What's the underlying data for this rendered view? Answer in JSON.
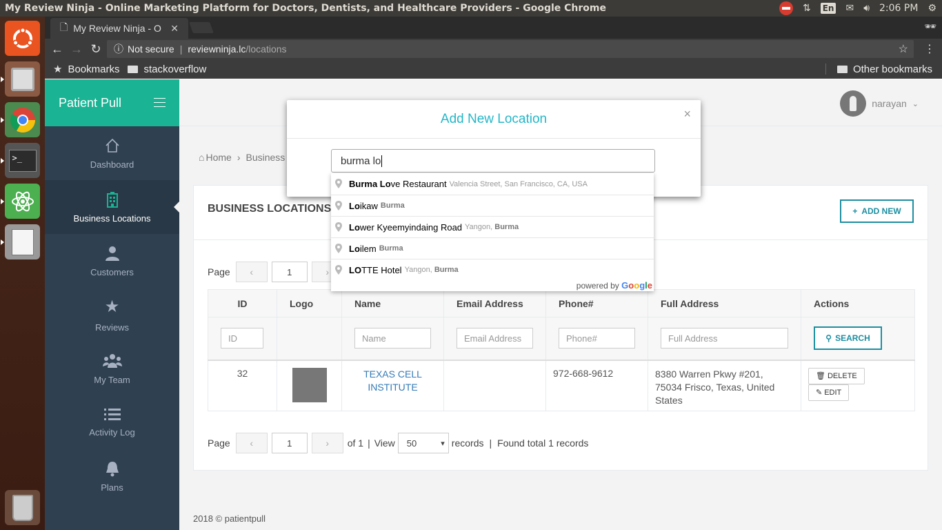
{
  "os": {
    "window_title": "My Review Ninja - Online Marketing Platform for Doctors, Dentists, and Healthcare Providers - Google Chrome",
    "lang": "En",
    "time": "2:06 PM"
  },
  "browser": {
    "tab_title": "My Review Ninja - O",
    "security": "Not secure",
    "url_host": "reviewninja.lc",
    "url_path": "/locations",
    "bookmarks": [
      "Bookmarks",
      "stackoverflow"
    ],
    "other_bookmarks": "Other bookmarks"
  },
  "sidebar": {
    "brand": "Patient Pull",
    "items": [
      {
        "label": "Dashboard",
        "icon": "home-icon"
      },
      {
        "label": "Business Locations",
        "icon": "building-icon"
      },
      {
        "label": "Customers",
        "icon": "user-icon"
      },
      {
        "label": "Reviews",
        "icon": "star-icon"
      },
      {
        "label": "My Team",
        "icon": "team-icon"
      },
      {
        "label": "Activity Log",
        "icon": "list-icon"
      },
      {
        "label": "Plans",
        "icon": "bell-icon"
      }
    ]
  },
  "header": {
    "user": "narayan"
  },
  "breadcrumb": {
    "home": "Home",
    "current": "Business"
  },
  "panel": {
    "title": "BUSINESS LOCATIONS",
    "add_new": "ADD NEW",
    "pager_label": "Page",
    "page": "1",
    "prev": "‹",
    "next": "›",
    "of_total": "of 1",
    "view_label": "View",
    "view_count": "50",
    "records_label": "records",
    "found": "Found total 1 records",
    "sep": "|"
  },
  "table": {
    "columns": [
      "ID",
      "Logo",
      "Name",
      "Email Address",
      "Phone#",
      "Full Address",
      "Actions"
    ],
    "filters": {
      "id": "ID",
      "name": "Name",
      "email": "Email Address",
      "phone": "Phone#",
      "address": "Full Address"
    },
    "search": "SEARCH",
    "rows": [
      {
        "id": "32",
        "name": "TEXAS CELL INSTITUTE",
        "email": "",
        "phone": "972-668-9612",
        "address": "8380 Warren Pkwy #201, 75034 Frisco, Texas, United States",
        "delete": "DELETE",
        "edit": "EDIT"
      }
    ]
  },
  "footer": "2018 © patientpull",
  "modal": {
    "title": "Add New Location",
    "close": "×",
    "input_value": "burma lo"
  },
  "autocomplete": {
    "items": [
      {
        "match": "Burma Lo",
        "rest": "ve Restaurant",
        "sub_pre": "Valencia Street, San Francisco, CA, USA",
        "sub_bold": ""
      },
      {
        "match": "Lo",
        "rest": "ikaw",
        "sub_pre": "",
        "sub_bold": "Burma"
      },
      {
        "match": "Lo",
        "rest": "wer Kyeemyindaing Road",
        "sub_pre": "Yangon, ",
        "sub_bold": "Burma"
      },
      {
        "match": "Lo",
        "rest": "ilem",
        "sub_pre": "",
        "sub_bold": "Burma"
      },
      {
        "match": "LO",
        "rest": "TTE Hotel",
        "sub_pre": "Yangon, ",
        "sub_bold": "Burma"
      }
    ],
    "powered_by": "powered by",
    "google": "Google"
  },
  "colors": {
    "brand_green": "#1ab394",
    "sidebar_bg": "#2f4050",
    "accent_teal": "#1c8ea0",
    "modal_title": "#23b7c8"
  }
}
